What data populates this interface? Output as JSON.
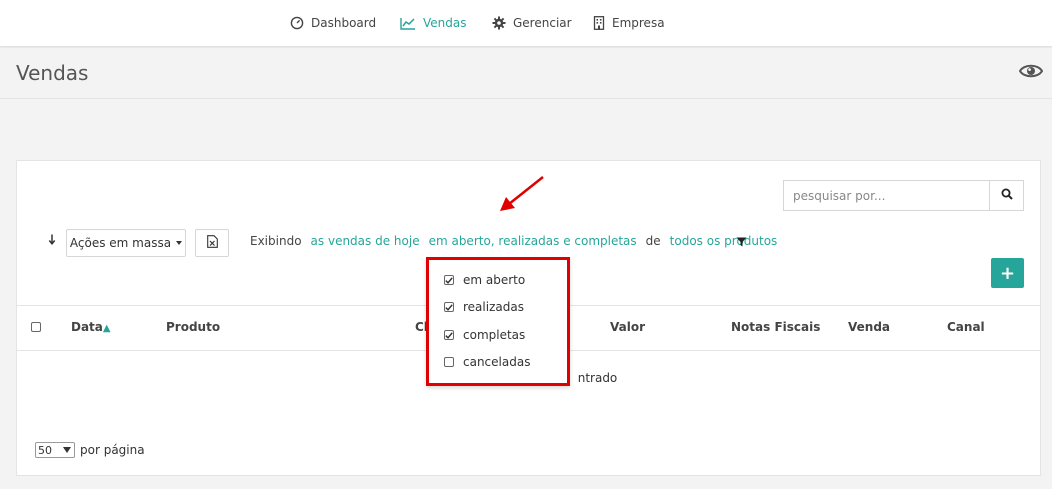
{
  "nav": {
    "items": [
      {
        "label": "Dashboard",
        "icon": "speedometer-icon",
        "active": false
      },
      {
        "label": "Vendas",
        "icon": "line-chart-icon",
        "active": true
      },
      {
        "label": "Gerenciar",
        "icon": "gear-icon",
        "active": false
      },
      {
        "label": "Empresa",
        "icon": "building-icon",
        "active": false
      }
    ]
  },
  "header": {
    "title": "Vendas",
    "visibility_icon": "eye-icon"
  },
  "toolbar": {
    "search_placeholder": "pesquisar por...",
    "search_icon": "search-icon",
    "bulk_actions_label": "Ações em massa",
    "export_icon": "excel-file-icon",
    "filter": {
      "prefix": "Exibindo",
      "period_link": "as vendas de hoje",
      "status_link": "em aberto, realizadas e completas",
      "connector": "de",
      "products_link": "todos os produtos"
    },
    "filter_icon": "funnel-icon",
    "add_label": "+"
  },
  "status_popover": {
    "options": [
      {
        "label": "em aberto",
        "checked": true
      },
      {
        "label": "realizadas",
        "checked": true
      },
      {
        "label": "completas",
        "checked": true
      },
      {
        "label": "canceladas",
        "checked": false
      }
    ]
  },
  "table": {
    "columns": [
      "Data",
      "Produto",
      "Cl",
      "Valor",
      "Notas Fiscais",
      "Venda",
      "Canal"
    ],
    "sort_indicator": "▲",
    "empty_message": "ntrado"
  },
  "pagination": {
    "per_page_value": "50",
    "per_page_label": "por página"
  },
  "colors": {
    "accent": "#26a69a",
    "highlight": "#e00000"
  }
}
